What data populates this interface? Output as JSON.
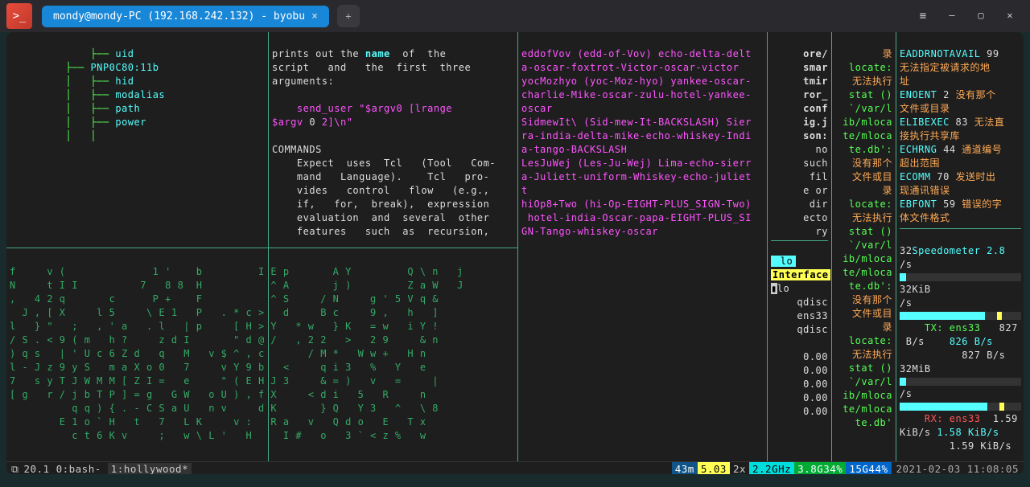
{
  "titlebar": {
    "tab_title": "mondy@mondy-PC (192.168.242.132) - byobu",
    "close_glyph": "×",
    "new_tab_glyph": "+",
    "menu_glyph": "≡",
    "min_glyph": "—",
    "max_glyph": "▢",
    "x_glyph": "✕",
    "app_glyph": ">_"
  },
  "pane_tree": {
    "lines": [
      "│       ├── uid",
      "├── PNP0C80:11b",
      "│   ├── hid",
      "│   ├── modalias",
      "│   ├── path",
      "│   ├── power",
      "│   │"
    ]
  },
  "pane_man": {
    "p1": "prints out the ",
    "name": "name",
    "p1b": "  of  the",
    "p2": "script   and   the  first  three",
    "p3": "arguments:",
    "p4": "    send_user \"$argv0 [lrange",
    "p5": "$argv ",
    "z": "0",
    "p5b": " 2]\\n\"",
    "cmd": "COMMANDS",
    "c1": "Expect  uses  Tcl   (Tool   Com-",
    "c2": "mand   Language).    Tcl   pro-",
    "c3": "vides   control   flow   (e.g.,",
    "c4": "if,   for,  break),  expression",
    "c5": "evaluation  and  several  other",
    "c6": "features   such  as  recursion,"
  },
  "pane_phon": {
    "lines": [
      "eddofVov (edd-of-Vov) echo-delta-delt",
      "a-oscar-foxtrot-Victor-oscar-victor",
      "yocMozhyo (yoc-Moz-hyo) yankee-oscar-",
      "charlie-Mike-oscar-zulu-hotel-yankee-",
      "oscar",
      "SidmewIt\\ (Sid-mew-It-BACKSLASH) Sier",
      "ra-india-delta-mike-echo-whiskey-Indi",
      "a-tango-BACKSLASH",
      "LesJuWej (Les-Ju-Wej) Lima-echo-sierr",
      "a-Juliett-uniform-Whiskey-echo-juliet",
      "t",
      "hiOp8+Two (hi-Op-EIGHT-PLUS_SIGN-Two)",
      " hotel-india-Oscar-papa-EIGHT-PLUS_SI",
      "GN-Tango-whiskey-oscar"
    ]
  },
  "pane_jq": {
    "lines": [
      "ore/",
      "smar",
      "tmir",
      "ror_",
      "conf",
      "ig.j",
      "son:",
      "  no",
      "such",
      " fil",
      "e or",
      " dir",
      "ecto",
      "ry"
    ]
  },
  "pane_locate": {
    "l1": "录",
    "l2": "locate:",
    "l3": "无法执行",
    "l4": " stat ()",
    "l5": " `/var/l",
    "l6": "ib/mloca",
    "l7": "te/mloca",
    "l8": "te.db':",
    "l9": "没有那个",
    "l10": "文件或目",
    "l11": "录",
    "l12": "locate:",
    "l13": "无法执行",
    "l14": " stat ()",
    "l15": " `/var/l",
    "l16": "ib/mloca",
    "l17": "te/mloca",
    "l18": "te.db':",
    "l19": "没有那个",
    "l20": "文件或目",
    "l21": "录",
    "l22": "locate:",
    "l23": "无法执行",
    "l24": " stat ()",
    "l25": " `/var/l",
    "l26": "ib/mloca",
    "l27": "te/mloca",
    "l28": "te.db'"
  },
  "pane_err": {
    "e1a": "EADDRNOTAVAIL",
    "e1b": "99",
    "e1c": "无法指定被请求的地",
    "e1d": "址",
    "e2a": "ENOENT",
    "e2b": "2",
    "e2c": "没有那个",
    "e2d": "文件或目录",
    "e3a": "ELIBEXEC",
    "e3b": "83",
    "e3c": "无法直",
    "e3d": "接执行共享库",
    "e4a": "ECHRNG",
    "e4b": "44",
    "e4c": "通道编号",
    "e4d": "超出范围",
    "e5a": "ECOMM",
    "e5b": "70",
    "e5c": "发送时出",
    "e5d": "现通讯错误",
    "e6a": "EBFONT",
    "e6b": "59",
    "e6c": "错误的字",
    "e6d": "体文件格式"
  },
  "pane_net": {
    "lo": " lo",
    "iface": "Interface",
    "lo2": "lo",
    "qdisc": "qdisc",
    "ens33": "ens33",
    "vals": [
      "0.00",
      "0.00",
      "0.00",
      "0.00",
      "0.00"
    ]
  },
  "pane_speed": {
    "s1": "32",
    "s1b": "Speedometer 2.8",
    "s2": "/s",
    "s3": "32KiB",
    "s4": "/s",
    "tx": "TX: ens33",
    "tx_v": "827",
    "bs": "B/s",
    "bs_v": "826 B/s",
    "bs2": "827 B/s",
    "m32": "32MiB",
    "m32b": "/s",
    "rx": "RX: ens33",
    "rx_v": "1.59",
    "kbs": "KiB/s",
    "kbs_v": "1.58 KiB/s",
    "kbs2": "1.59 KiB/s"
  },
  "pane_matrix": {
    "rows": [
      "f     v (              1 '    b         I E p       A Y         Q \\ n   j",
      "N     t I I          7   8 8  H           ^ A       j )         Z a W   J",
      ",   4 2 q       c      P +    F           ^ S     / N     g ' 5 V q &   ",
      "  J , [ X     l 5     \\ E 1   P   . * c >   d     B c     9 ,   h   ]",
      "l   } \"   ;   , ' a   . l   | p     [ H > Y   * w   } K   = w   i Y !",
      "/ S . < 9 ( m   h ?     z d I       \" d @ /   , 2 2   >   2 9     & n",
      ") q s   | ' U c 6 Z d   q   M   v $ ^ , c       / M *   W w +   H n",
      "l - J z 9 y S   m a X o 0   7     v Y 9 b   <     q i 3   %   Y   e",
      "7   s y T J W M M [ Z I =   e     \" ( E H J 3     & = )   v   =     |",
      "[ g   r / j b T P ] = g   G W   o U ) , f X     < d i   5   R     n",
      "          q q ) { . - C S a U   n v     d K       } Q   Y 3   ^   \\ 8",
      "        E 1 o ` H   t   7   L K     v :   R a   v   Q d o   E   T x",
      "          c t 6 K v     ;   w \\ L '   H     I #   o   3 ` < z %   w"
    ]
  },
  "statusbar": {
    "icon": "⧉",
    "left": "20.1 0:bash- ",
    "active": "1:hollywood*",
    "c1": "43m",
    "c2": "5.03",
    "c3a": "2x",
    "c3b": "2.2GHz",
    "c4": "3.8G34%",
    "c5": "15G44%",
    "time": "2021-02-03 11:08:05"
  }
}
